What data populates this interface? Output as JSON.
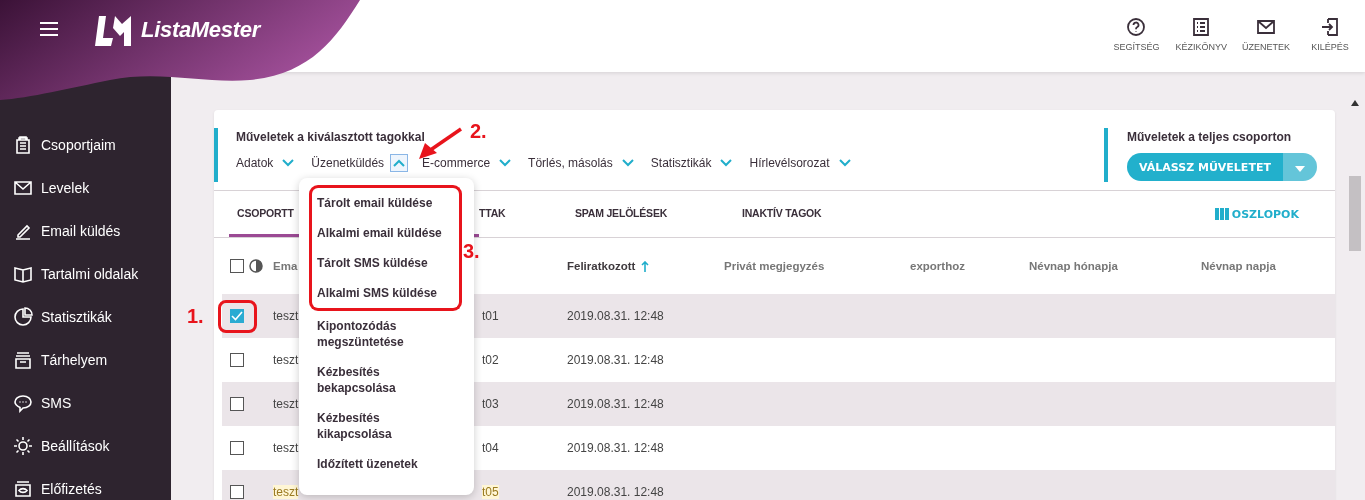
{
  "header": {
    "logo": "ListaMester",
    "actions": [
      {
        "label": "SEGÍTSÉG"
      },
      {
        "label": "KÉZIKÖNYV"
      },
      {
        "label": "ÜZENETEK"
      },
      {
        "label": "KILÉPÉS"
      }
    ]
  },
  "sidebar": {
    "items": [
      {
        "label": "Csoportjaim"
      },
      {
        "label": "Levelek"
      },
      {
        "label": "Email küldés"
      },
      {
        "label": "Tartalmi oldalak"
      },
      {
        "label": "Statisztikák"
      },
      {
        "label": "Tárhelyem"
      },
      {
        "label": "SMS"
      },
      {
        "label": "Beállítások"
      },
      {
        "label": "Előfizetés"
      }
    ]
  },
  "selection_actions": {
    "title": "Műveletek a kiválasztott tagokkal",
    "menus": [
      {
        "label": "Adatok",
        "expanded": false
      },
      {
        "label": "Üzenetküldés",
        "expanded": true
      },
      {
        "label": "E-commerce",
        "expanded": false
      },
      {
        "label": "Törlés, másolás",
        "expanded": false
      },
      {
        "label": "Statisztikák",
        "expanded": false
      },
      {
        "label": "Hírlevélsorozat",
        "expanded": false
      }
    ]
  },
  "group_actions": {
    "title": "Műveletek a teljes csoporton",
    "button": "VÁLASSZ MŰVELETET"
  },
  "tabs": [
    {
      "label": "CSOPORTT",
      "selected": true
    },
    {
      "label": "TTAK",
      "selected": false
    },
    {
      "label": "SPAM JELÖLÉSEK",
      "selected": false
    },
    {
      "label": "INAKTÍV TAGOK",
      "selected": false
    }
  ],
  "columns_button": "OSZLOPOK",
  "table": {
    "all_checked": false,
    "columns": [
      {
        "label": "Ema",
        "sorted": false
      },
      {
        "label": "Feliratkozott",
        "sorted": true
      },
      {
        "label": "Privát megjegyzés",
        "sorted": false
      },
      {
        "label": "exporthoz",
        "sorted": false
      },
      {
        "label": "Névnap hónapja",
        "sorted": false
      },
      {
        "label": "Névnap napja",
        "sorted": false
      }
    ],
    "rows": [
      {
        "checked": true,
        "highlighted": false,
        "email": "teszt",
        "column_2": "t01",
        "subscribed": "2019.08.31. 12:48"
      },
      {
        "checked": false,
        "highlighted": false,
        "email": "teszt",
        "column_2": "t02",
        "subscribed": "2019.08.31. 12:48"
      },
      {
        "checked": false,
        "highlighted": false,
        "email": "teszt",
        "column_2": "t03",
        "subscribed": "2019.08.31. 12:48"
      },
      {
        "checked": false,
        "highlighted": false,
        "email": "teszt",
        "column_2": "t04",
        "subscribed": "2019.08.31. 12:48"
      },
      {
        "checked": false,
        "highlighted": true,
        "email": "teszt",
        "column_2": "t05",
        "subscribed": "2019.08.31. 12:48"
      }
    ]
  },
  "dropdown": {
    "items": [
      {
        "label": "Tárolt email küldése",
        "marked": true
      },
      {
        "label": "Alkalmi email küldése",
        "marked": true
      },
      {
        "label": "Tárolt SMS küldése",
        "marked": true
      },
      {
        "label": "Alkalmi SMS küldése",
        "marked": true
      },
      {
        "label": "Kipontozódás megszüntetése",
        "marked": false
      },
      {
        "label": "Kézbesítés bekapcsolása",
        "marked": false
      },
      {
        "label": "Kézbesítés kikapcsolása",
        "marked": false
      },
      {
        "label": "Időzített üzenetek",
        "marked": false
      }
    ]
  },
  "annotations": [
    {
      "label": "1."
    },
    {
      "label": "2."
    },
    {
      "label": "3."
    }
  ]
}
